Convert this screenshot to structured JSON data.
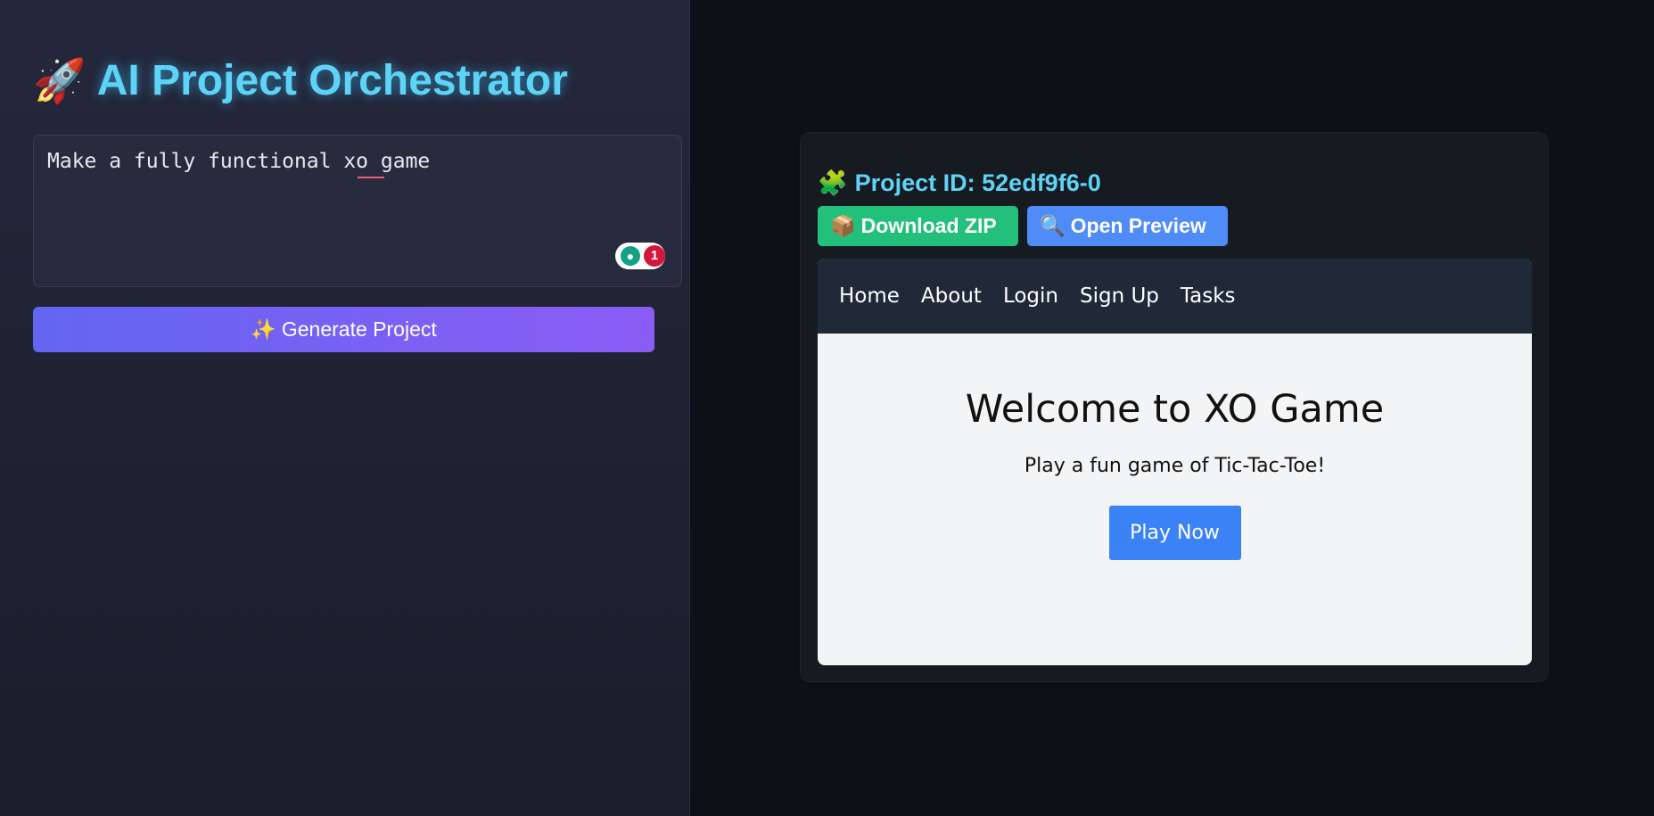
{
  "app": {
    "title": "AI Project Orchestrator",
    "title_icon": "🚀"
  },
  "prompt": {
    "value": "Make a fully functional xo game",
    "grammar_issue_count": "1"
  },
  "generate": {
    "label": "Generate Project",
    "icon": "✨"
  },
  "result": {
    "project_icon": "🧩",
    "project_id_label": "Project ID: 52edf9f6-0",
    "download_icon": "📦",
    "download_label": "Download ZIP",
    "preview_icon": "🔍",
    "preview_label": "Open Preview"
  },
  "preview": {
    "nav": [
      "Home",
      "About",
      "Login",
      "Sign Up",
      "Tasks"
    ],
    "heading": "Welcome to XO Game",
    "subtitle": "Play a fun game of Tic-Tac-Toe!",
    "play_label": "Play Now"
  },
  "colors": {
    "accent_cyan": "#5fd3f5",
    "download_green": "#22c07a",
    "preview_blue": "#4f8cf7",
    "generate_gradient_start": "#6366f1",
    "generate_gradient_end": "#8b5cf6"
  }
}
